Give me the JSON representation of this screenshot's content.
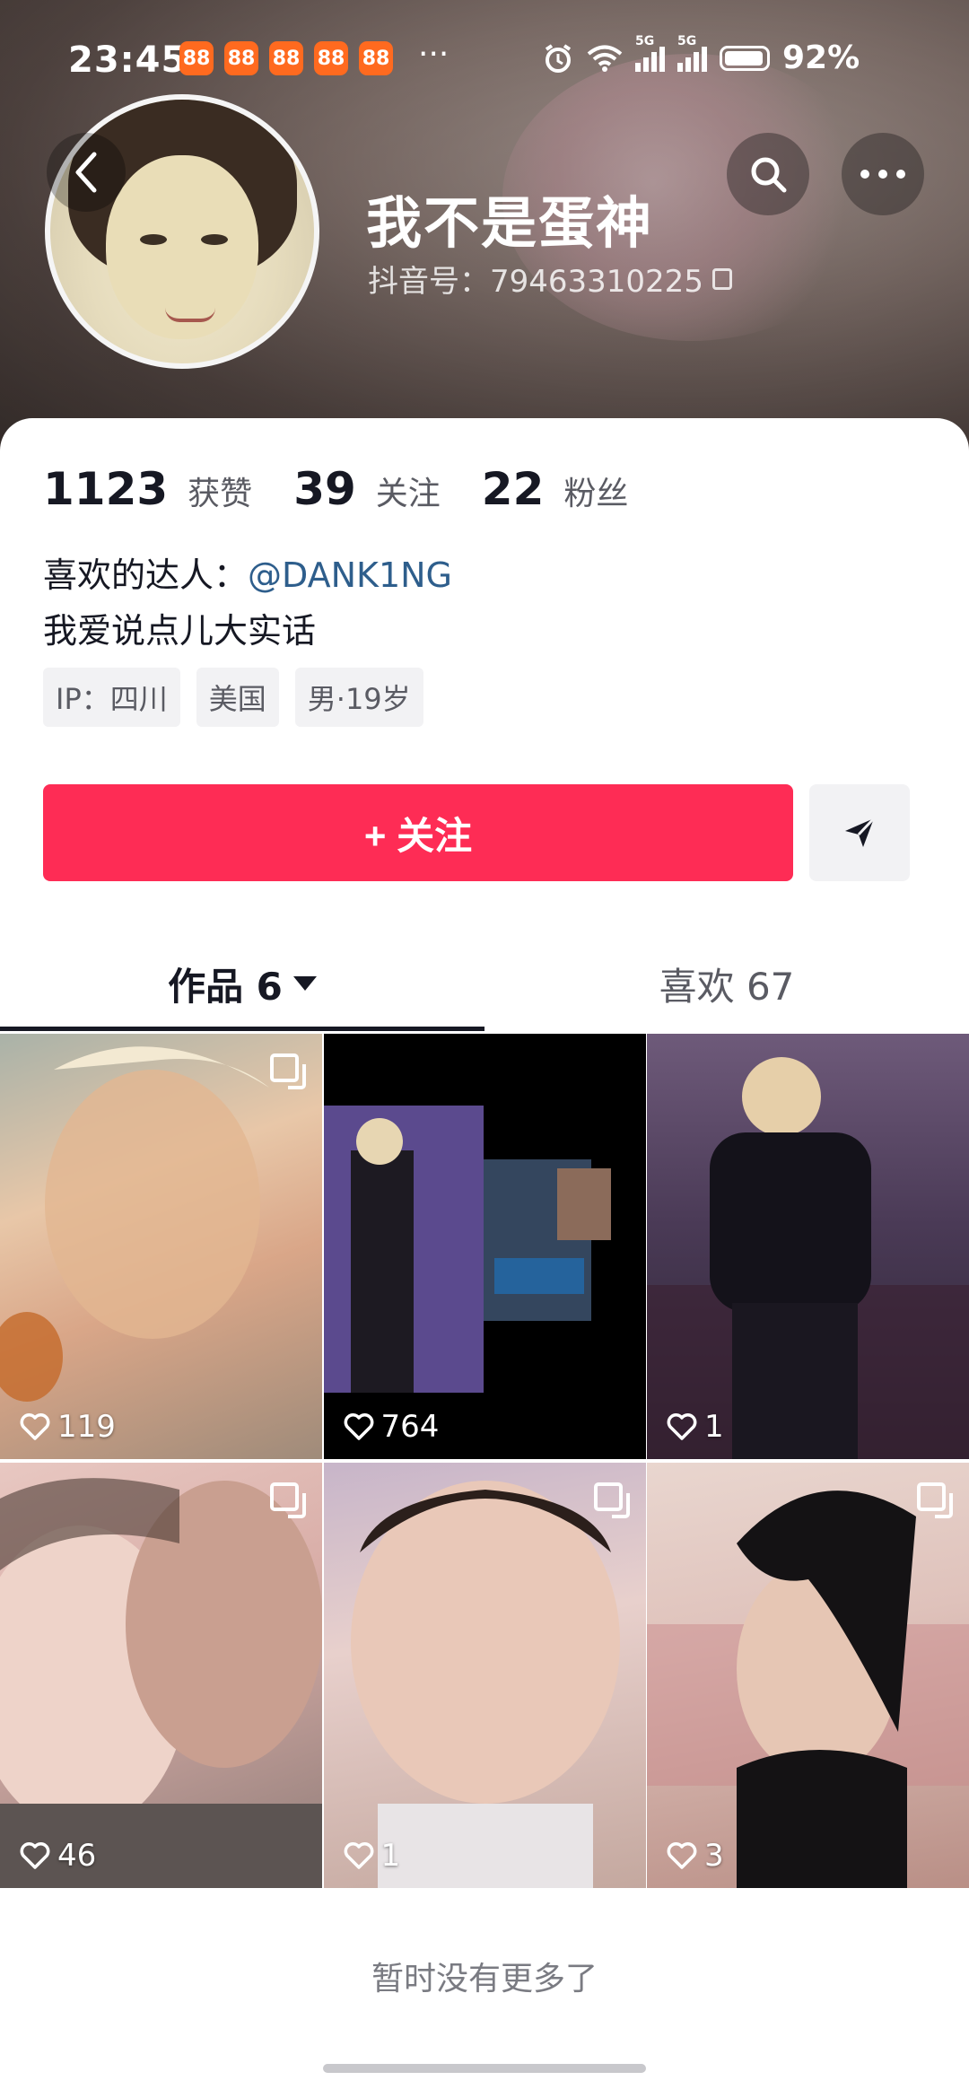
{
  "status_bar": {
    "time": "23:45",
    "app_icons": [
      "app-icon",
      "app-icon",
      "app-icon",
      "app-icon",
      "app-icon"
    ],
    "more": "···",
    "signal_1": "5G",
    "signal_2": "5G",
    "battery": "92%"
  },
  "profile": {
    "name": "我不是蛋神",
    "id_label": "抖音号：79463310225"
  },
  "stats": {
    "likes_count": "1123",
    "likes_label": "获赞",
    "following_count": "39",
    "following_label": "关注",
    "followers_count": "22",
    "followers_label": "粉丝"
  },
  "bio": {
    "fav_prefix": "喜欢的达人：",
    "fav_link": "@DANK1NG",
    "text": "我爱说点儿大实话"
  },
  "tags": [
    "IP：四川",
    "美国",
    "男·19岁"
  ],
  "actions": {
    "follow": "+ 关注"
  },
  "tabs": {
    "works": "作品 6",
    "likes": "喜欢 67"
  },
  "videos": [
    {
      "likes": "119"
    },
    {
      "likes": "764"
    },
    {
      "likes": "1"
    },
    {
      "likes": "46"
    },
    {
      "likes": "1"
    },
    {
      "likes": "3"
    }
  ],
  "footer": {
    "no_more": "暂时没有更多了"
  },
  "colors": {
    "accent": "#fe2c55",
    "link": "#2e5e8c"
  }
}
